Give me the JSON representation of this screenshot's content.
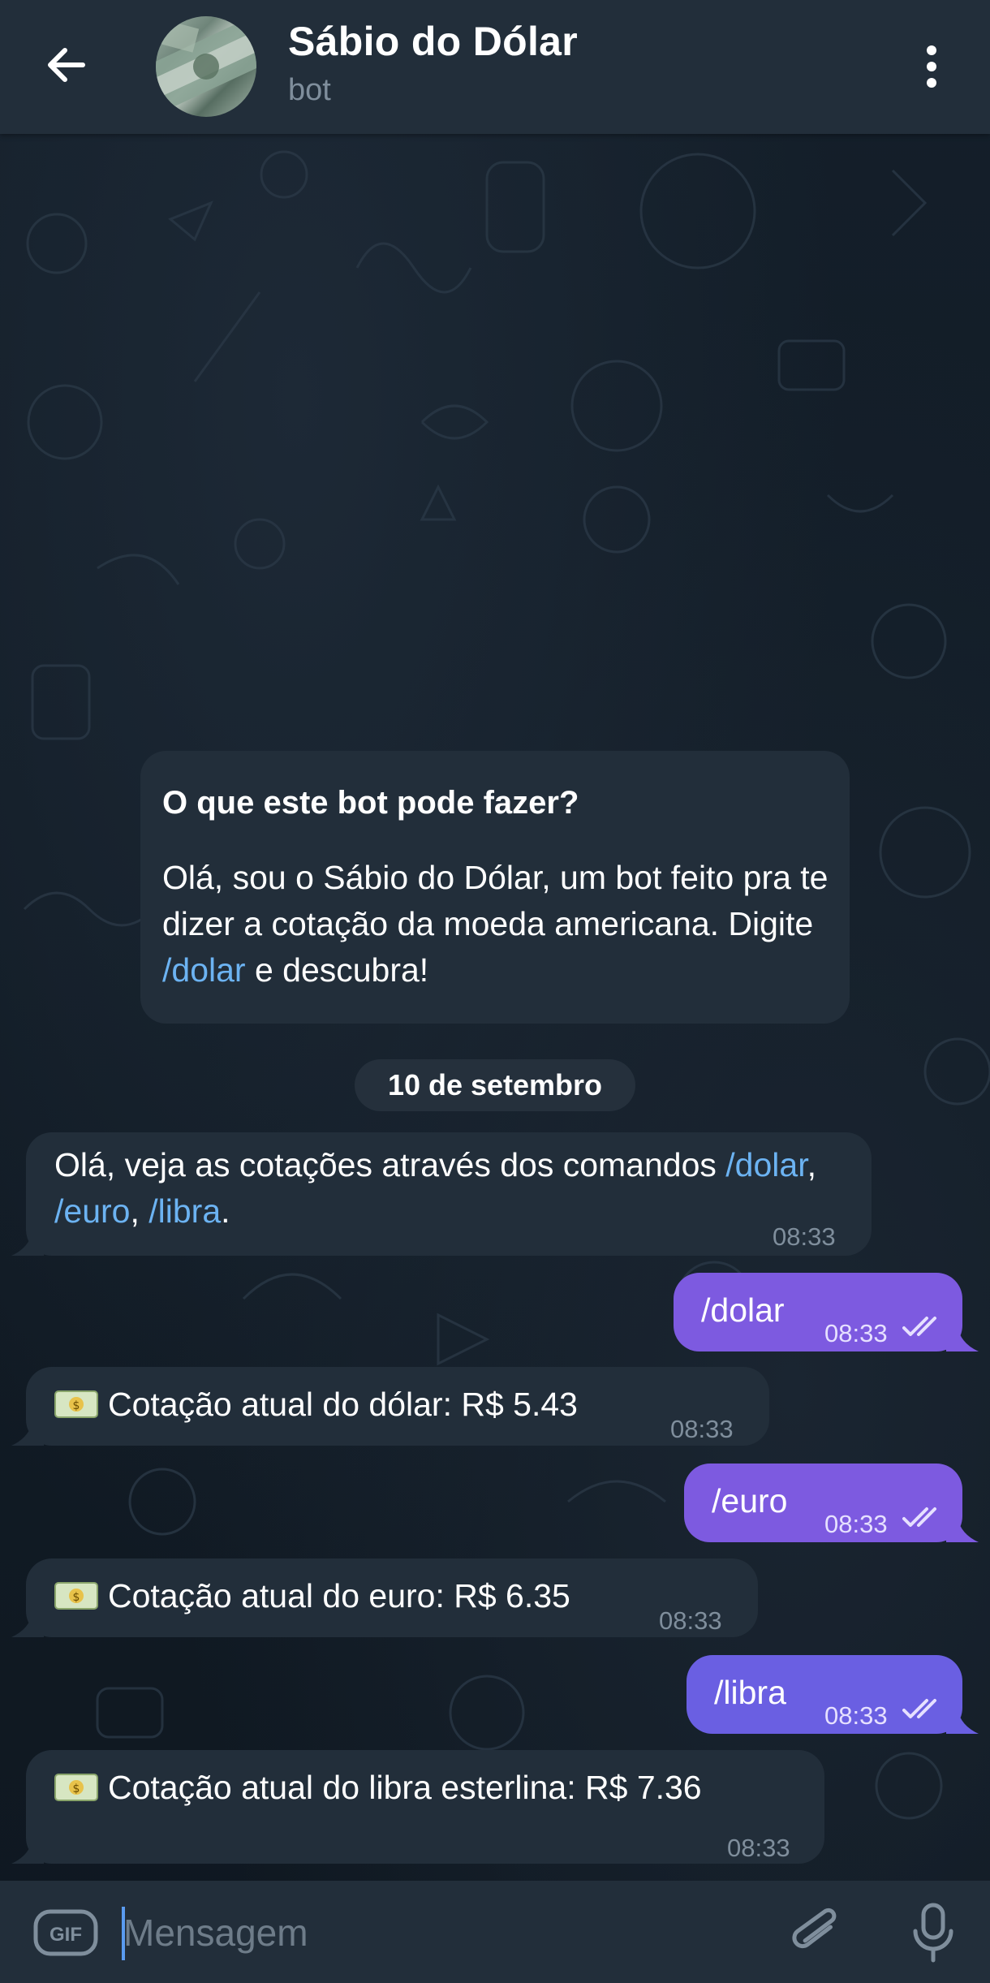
{
  "header": {
    "title": "Sábio do Dólar",
    "subtitle": "bot"
  },
  "intro": {
    "heading": "O que este bot pode fazer?",
    "text_before": "Olá, sou o Sábio do Dólar, um bot feito pra te dizer a cotação da moeda americana. Digite ",
    "command": "/dolar",
    "text_after": " e descubra!"
  },
  "date_separator": "10 de setembro",
  "messages": [
    {
      "direction": "in",
      "text_before": "Olá, veja as cotações através dos comandos ",
      "cmd1": "/dolar",
      "sep1": ", ",
      "cmd2": "/euro",
      "sep2": ", ",
      "cmd3": "/libra",
      "end": ".",
      "time": "08:33"
    },
    {
      "direction": "out",
      "text": "/dolar",
      "time": "08:33"
    },
    {
      "direction": "in",
      "emoji": "money-bill-emoji",
      "text": "Cotação atual do dólar: R$ 5.43",
      "time": "08:33"
    },
    {
      "direction": "out",
      "text": "/euro",
      "time": "08:33"
    },
    {
      "direction": "in",
      "emoji": "money-bill-emoji",
      "text": "Cotação atual do euro: R$ 6.35",
      "time": "08:33"
    },
    {
      "direction": "out",
      "text": "/libra",
      "time": "08:33"
    },
    {
      "direction": "in",
      "emoji": "money-bill-emoji",
      "text": "Cotação atual do libra esterlina: R$ 7.36",
      "time": "08:33"
    }
  ],
  "composer": {
    "placeholder": "Mensagem",
    "gif_label": "GIF"
  },
  "colors": {
    "header_bg": "#222e3a",
    "incoming_bubble": "#222e3a",
    "outgoing_bubble": "#7d5ae0",
    "link": "#6cb3f2",
    "timestamp": "#7f8e9c"
  }
}
